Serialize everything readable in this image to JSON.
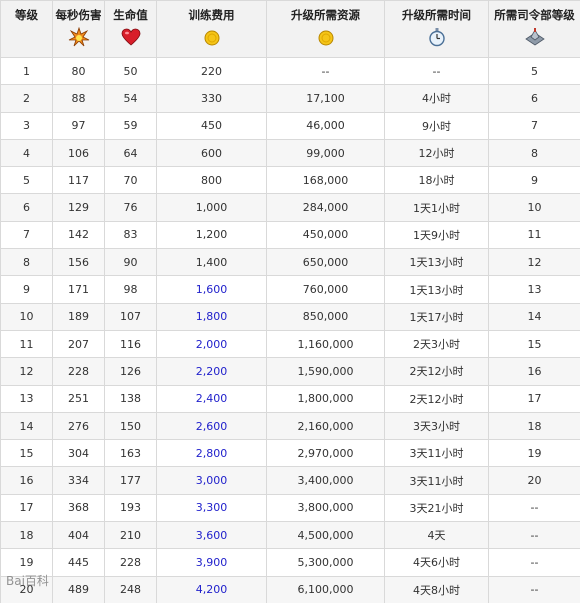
{
  "table": {
    "headers": [
      {
        "label": "等级",
        "icon": ""
      },
      {
        "label": "每秒伤害",
        "icon": "explosion-icon"
      },
      {
        "label": "生命值",
        "icon": "heart-icon"
      },
      {
        "label": "训练费用",
        "icon": "gold-coin-icon"
      },
      {
        "label": "升级所需资源",
        "icon": "gold-coin-icon"
      },
      {
        "label": "升级所需时间",
        "icon": "stopwatch-icon"
      },
      {
        "label": "所需司令部等级",
        "icon": "headquarters-icon"
      }
    ],
    "rows": [
      [
        "1",
        "80",
        "50",
        "220",
        "--",
        "--",
        "5"
      ],
      [
        "2",
        "88",
        "54",
        "330",
        "17,100",
        "4小时",
        "6"
      ],
      [
        "3",
        "97",
        "59",
        "450",
        "46,000",
        "9小时",
        "7"
      ],
      [
        "4",
        "106",
        "64",
        "600",
        "99,000",
        "12小时",
        "8"
      ],
      [
        "5",
        "117",
        "70",
        "800",
        "168,000",
        "18小时",
        "9"
      ],
      [
        "6",
        "129",
        "76",
        "1,000",
        "284,000",
        "1天1小时",
        "10"
      ],
      [
        "7",
        "142",
        "83",
        "1,200",
        "450,000",
        "1天9小时",
        "11"
      ],
      [
        "8",
        "156",
        "90",
        "1,400",
        "650,000",
        "1天13小时",
        "12"
      ],
      [
        "9",
        "171",
        "98",
        "1,600",
        "760,000",
        "1天13小时",
        "13"
      ],
      [
        "10",
        "189",
        "107",
        "1,800",
        "850,000",
        "1天17小时",
        "14"
      ],
      [
        "11",
        "207",
        "116",
        "2,000",
        "1,160,000",
        "2天3小时",
        "15"
      ],
      [
        "12",
        "228",
        "126",
        "2,200",
        "1,590,000",
        "2天12小时",
        "16"
      ],
      [
        "13",
        "251",
        "138",
        "2,400",
        "1,800,000",
        "2天12小时",
        "17"
      ],
      [
        "14",
        "276",
        "150",
        "2,600",
        "2,160,000",
        "3天3小时",
        "18"
      ],
      [
        "15",
        "304",
        "163",
        "2,800",
        "2,970,000",
        "3天11小时",
        "19"
      ],
      [
        "16",
        "334",
        "177",
        "3,000",
        "3,400,000",
        "3天11小时",
        "20"
      ],
      [
        "17",
        "368",
        "193",
        "3,300",
        "3,800,000",
        "3天21小时",
        "--"
      ],
      [
        "18",
        "404",
        "210",
        "3,600",
        "4,500,000",
        "4天",
        "--"
      ],
      [
        "19",
        "445",
        "228",
        "3,900",
        "5,300,000",
        "4天6小时",
        "--"
      ],
      [
        "20",
        "489",
        "248",
        "4,200",
        "6,100,000",
        "4天8小时",
        "--"
      ]
    ],
    "blue_from_row": 9
  },
  "watermark": "Bai百科",
  "colors": {
    "highlight_text": "#2222cc",
    "header_bg": "#f2f2f2",
    "border": "#d9d9d9"
  }
}
